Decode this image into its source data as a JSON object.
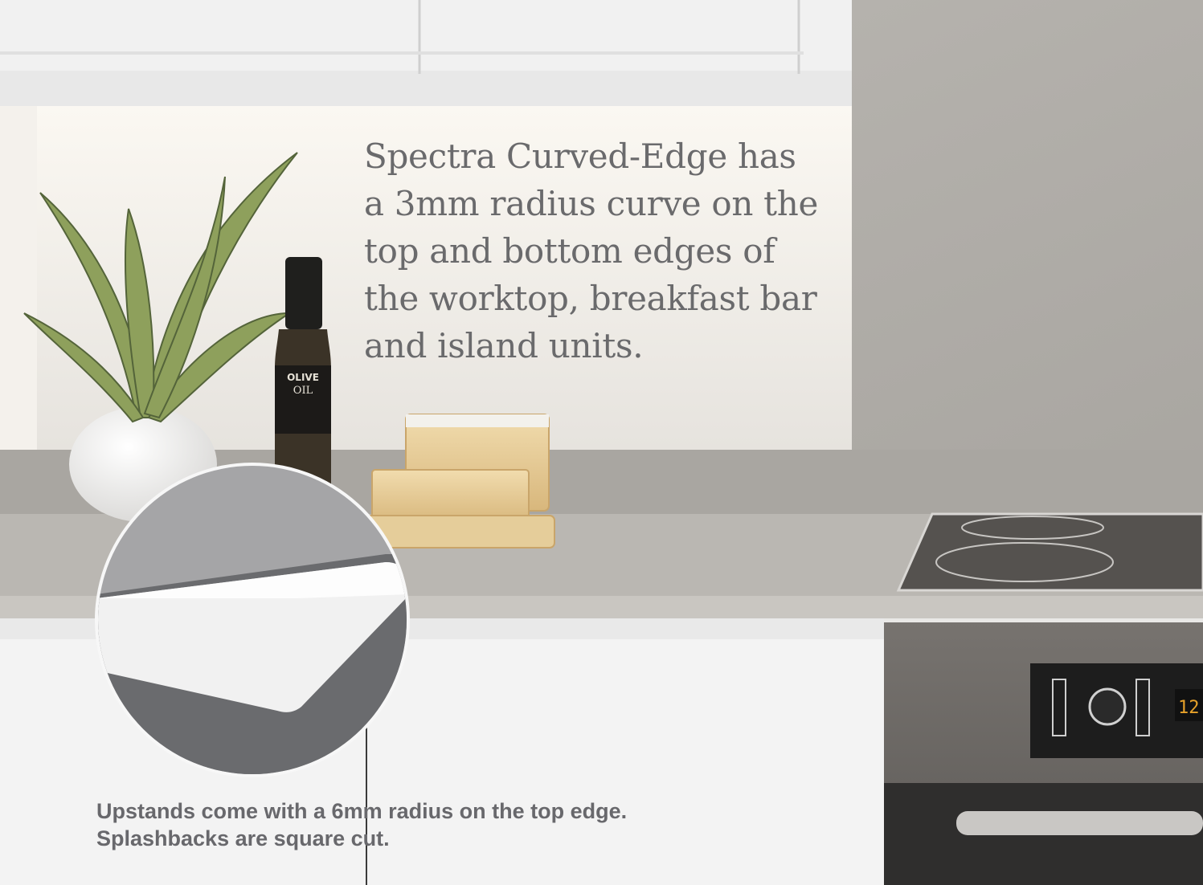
{
  "headline": {
    "lines": [
      "Spectra Curved-Edge has",
      "a 3mm radius curve on the",
      "top and bottom edges of",
      "the worktop, breakfast bar",
      "and island units."
    ]
  },
  "bottle_label": {
    "line1": "OLIVE",
    "line2": "OIL"
  },
  "caption": {
    "lines": [
      "Upstands come with a 6mm radius on the top edge.",
      "Splashbacks are square cut."
    ]
  },
  "colors": {
    "text_headline": "#6a6a6c",
    "text_caption": "#68686c",
    "worktop": "#b9b6b1",
    "cabinet_white": "#f2f2f2",
    "splashback_concrete": "#b3b0ab",
    "oven_steel": "#6f6c68"
  },
  "icons": [
    "edge-profile-detail-icon",
    "oven-control-knob-icon",
    "hob-ring-icon"
  ]
}
